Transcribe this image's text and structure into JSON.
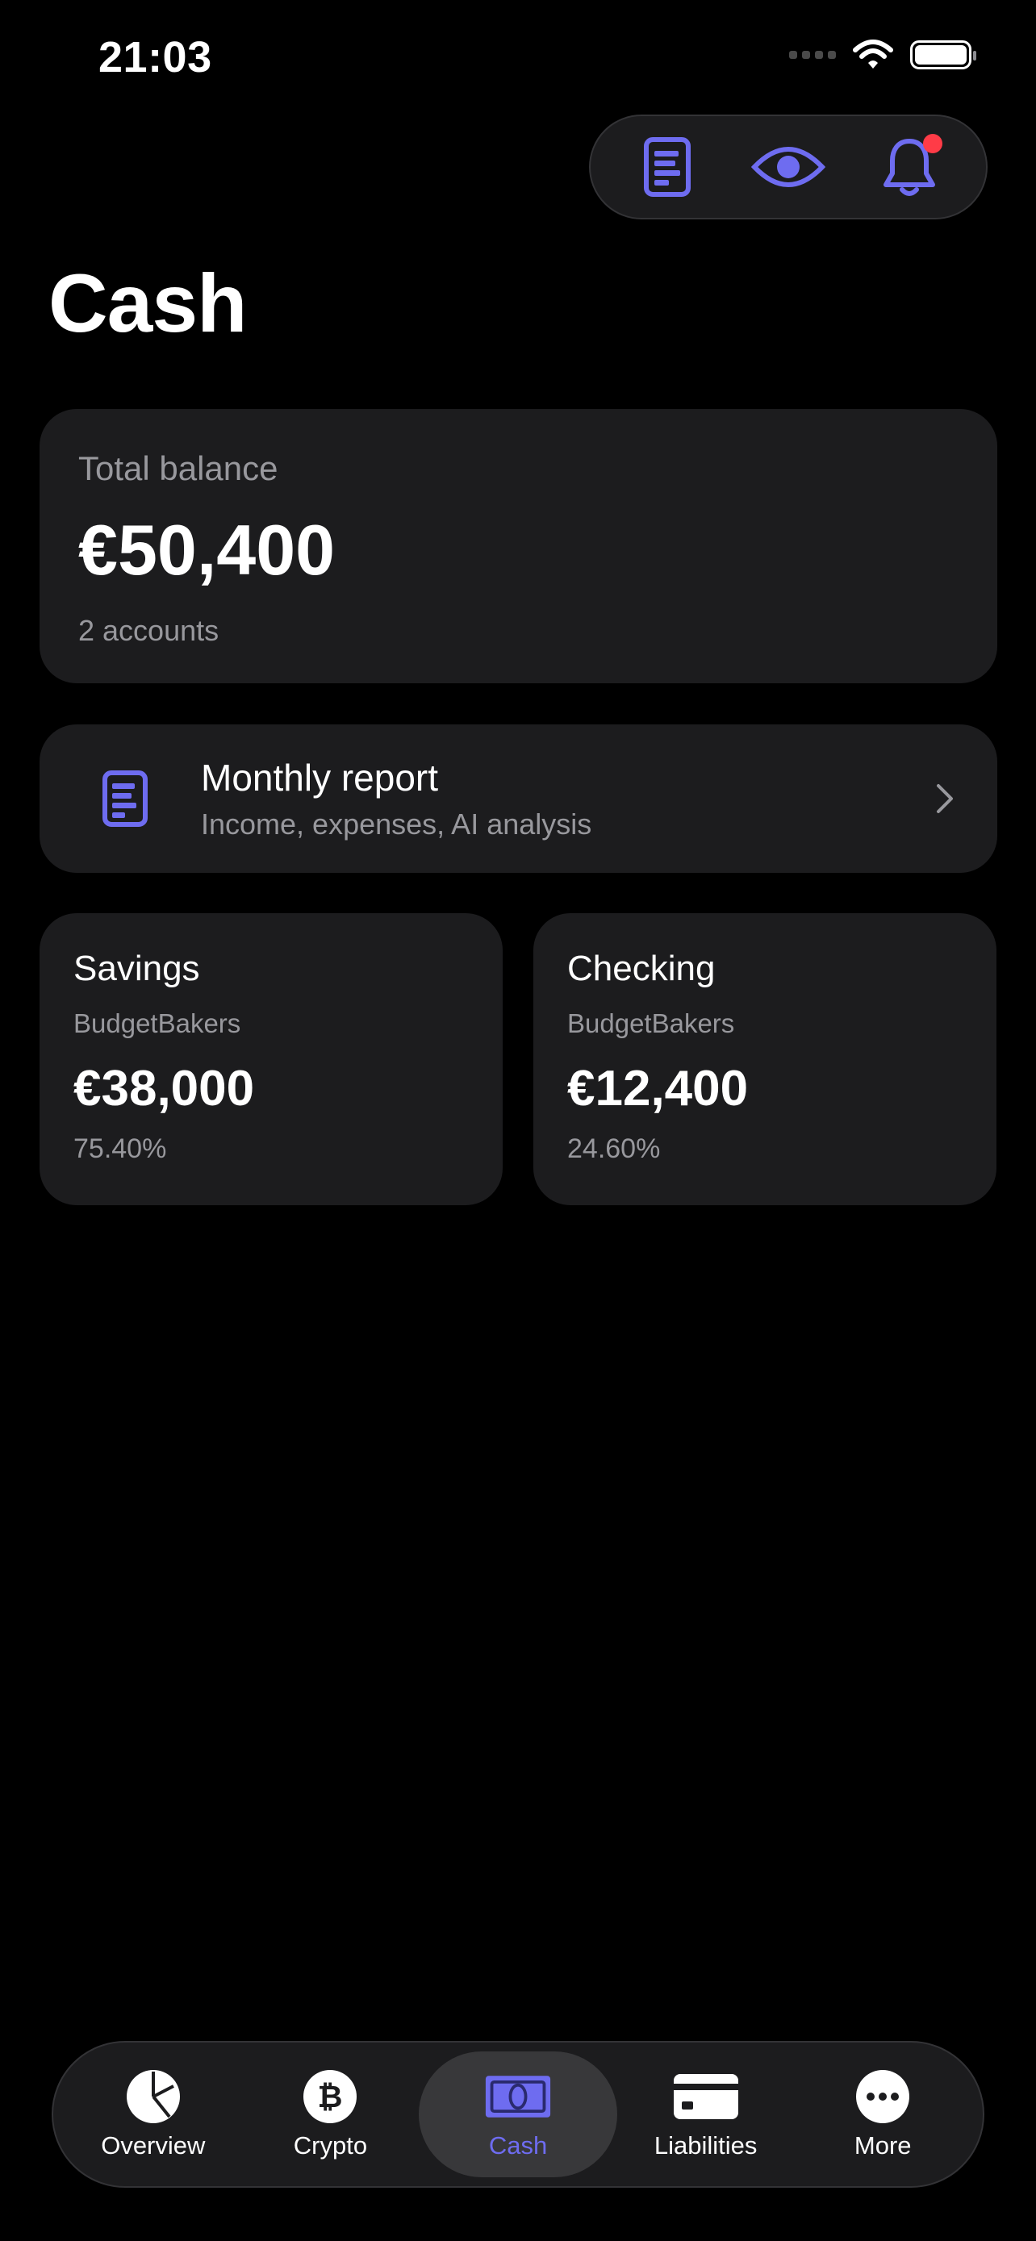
{
  "status_bar": {
    "time": "21:03"
  },
  "colors": {
    "accent": "#6e6cf0",
    "notification": "#ff3b47",
    "card": "#1c1c1e",
    "muted_text": "#98989d"
  },
  "top_actions": [
    {
      "icon": "report-icon"
    },
    {
      "icon": "eye-icon"
    },
    {
      "icon": "bell-icon",
      "has_notification": true
    }
  ],
  "page_title": "Cash",
  "balance": {
    "label": "Total balance",
    "amount": "€50,400",
    "accounts": "2 accounts"
  },
  "report": {
    "title": "Monthly report",
    "subtitle": "Income, expenses, AI analysis"
  },
  "accounts": [
    {
      "name": "Savings",
      "bank": "BudgetBakers",
      "amount": "€38,000",
      "percent": "75.40%"
    },
    {
      "name": "Checking",
      "bank": "BudgetBakers",
      "amount": "€12,400",
      "percent": "24.60%"
    }
  ],
  "tabs": [
    {
      "label": "Overview",
      "icon": "pie-chart-icon"
    },
    {
      "label": "Crypto",
      "icon": "bitcoin-icon"
    },
    {
      "label": "Cash",
      "icon": "banknote-icon",
      "active": true
    },
    {
      "label": "Liabilities",
      "icon": "credit-card-icon"
    },
    {
      "label": "More",
      "icon": "more-icon"
    }
  ]
}
